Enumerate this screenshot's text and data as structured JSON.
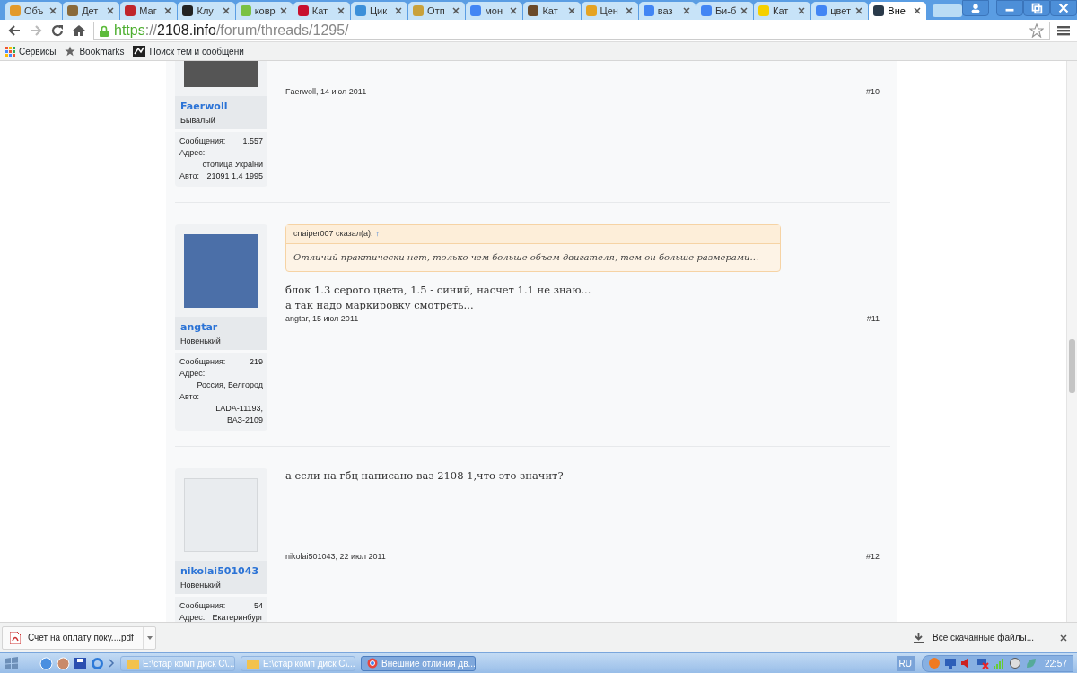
{
  "browser": {
    "tabs": [
      {
        "title": "Объ",
        "selected": false,
        "color": "#e39a2a"
      },
      {
        "title": "Дет",
        "selected": false,
        "color": "#8a6a3a"
      },
      {
        "title": "Маг",
        "selected": false,
        "color": "#c0262b"
      },
      {
        "title": "Клу",
        "selected": false,
        "color": "#222222"
      },
      {
        "title": "ковр",
        "selected": false,
        "color": "#7ac143"
      },
      {
        "title": "Кат",
        "selected": false,
        "color": "#c8102e"
      },
      {
        "title": "Цик",
        "selected": false,
        "color": "#3b8fd9"
      },
      {
        "title": "Отп",
        "selected": false,
        "color": "#c9a13b"
      },
      {
        "title": "мон",
        "selected": false,
        "color": "#4285f4"
      },
      {
        "title": "Кат",
        "selected": false,
        "color": "#6b4a2a"
      },
      {
        "title": "Цен",
        "selected": false,
        "color": "#e5a323"
      },
      {
        "title": "ваз",
        "selected": false,
        "color": "#4285f4"
      },
      {
        "title": "Би-б",
        "selected": false,
        "color": "#4285f4"
      },
      {
        "title": "Кат",
        "selected": false,
        "color": "#f5d000"
      },
      {
        "title": "цвет",
        "selected": false,
        "color": "#4285f4"
      },
      {
        "title": "Вне",
        "selected": true,
        "color": "#2a3a4a"
      }
    ],
    "address": {
      "scheme": "https",
      "separator": "://",
      "host": "2108.info",
      "path": "/forum/threads/1295/"
    },
    "bookmarks": [
      {
        "label": "Сервисы",
        "kind": "apps"
      },
      {
        "label": "Bookmarks",
        "kind": "star"
      },
      {
        "label": "Поиск тем и сообщени",
        "kind": "site"
      }
    ]
  },
  "posts": [
    {
      "author": "Faerwoll",
      "rank": "Бывалый",
      "stats": [
        {
          "label": "Сообщения:",
          "value": "1.557"
        },
        {
          "label": "Адрес:",
          "value": "столица Украіни"
        },
        {
          "label": "Авто:",
          "value": "21091 1,4 1995"
        }
      ],
      "date": "Faerwoll, 14 июл 2011",
      "number": "#10"
    },
    {
      "author": "angtar",
      "rank": "Новенький",
      "stats": [
        {
          "label": "Сообщения:",
          "value": "219"
        },
        {
          "label": "Адрес:",
          "value": "Россия, Белгород"
        },
        {
          "label": "Авто:",
          "value": "LADA-11193, ВАЗ-2109"
        }
      ],
      "quote": {
        "author": "cnaiper007 сказал(а):",
        "arrow": "↑",
        "text": "Отличий практически нет, только чем больше объем двигателя, тем он больше размерами..."
      },
      "message": "блок 1.3 серого цвета, 1.5 - синий, насчет 1.1 не знаю...\nа так надо маркировку смотреть...",
      "date": "angtar, 15 июл 2011",
      "number": "#11"
    },
    {
      "author": "nikolai501043",
      "rank": "Новенький",
      "stats": [
        {
          "label": "Сообщения:",
          "value": "54"
        },
        {
          "label": "Адрес:",
          "value": "Екатеринбург"
        }
      ],
      "message": "а если на гбц написано ваз 2108 1,что это значит?",
      "date": "nikolai501043, 22 июл 2011",
      "number": "#12"
    }
  ],
  "downloads": {
    "file": "Счет на оплату поку....pdf",
    "show_all": "Все скачанные файлы..."
  },
  "taskbar": {
    "tasks": [
      {
        "label": "E:\\стар комп диск С\\...",
        "kind": "folder",
        "selected": false
      },
      {
        "label": "E:\\стар комп диск С\\...",
        "kind": "folder",
        "selected": false
      },
      {
        "label": "Внешние отличия дв...",
        "kind": "browser",
        "selected": true
      }
    ],
    "language": "RU",
    "clock": "22:57"
  }
}
